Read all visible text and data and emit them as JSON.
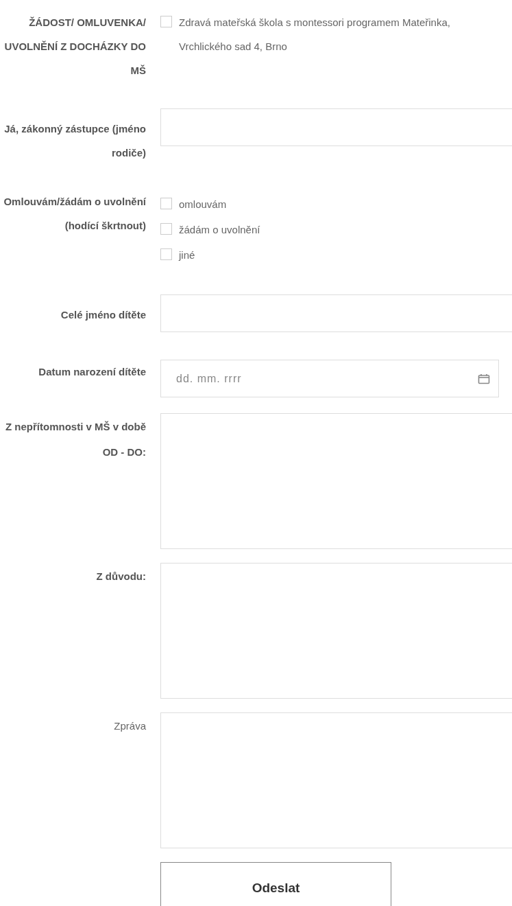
{
  "fields": [
    {
      "kind": "checkbox-group",
      "label": "ŽÁDOST/ OMLUVENKA/ UVOLNĚNÍ Z DOCHÁZKY DO MŠ",
      "bold": true,
      "options": [
        {
          "label": "Zdravá mateřská škola s montessori programem Mateřinka, Vrchlického sad 4, Brno",
          "checked": false
        }
      ]
    },
    {
      "kind": "text",
      "label": "Já, zákonný zástupce (jméno rodiče)",
      "bold": true
    },
    {
      "kind": "checkbox-group",
      "label": "Omlouvám/žádám o uvolnění (hodící škrtnout)",
      "bold": true,
      "options": [
        {
          "label": "omlouvám",
          "checked": false
        },
        {
          "label": "žádám o uvolnění",
          "checked": false
        },
        {
          "label": "jiné",
          "checked": false
        }
      ]
    },
    {
      "kind": "text",
      "label": "Celé jméno dítěte",
      "bold": true
    },
    {
      "kind": "date",
      "label": "Datum narození dítěte",
      "bold": true,
      "placeholder": "dd. mm. rrrr"
    },
    {
      "kind": "textarea",
      "label": "Z nepřítomnosti v MŠ v době OD - DO:",
      "bold": true
    },
    {
      "kind": "textarea",
      "label": "Z důvodu:",
      "bold": true
    },
    {
      "kind": "textarea",
      "label": "Zpráva",
      "bold": false
    }
  ],
  "submit": "Odeslat"
}
